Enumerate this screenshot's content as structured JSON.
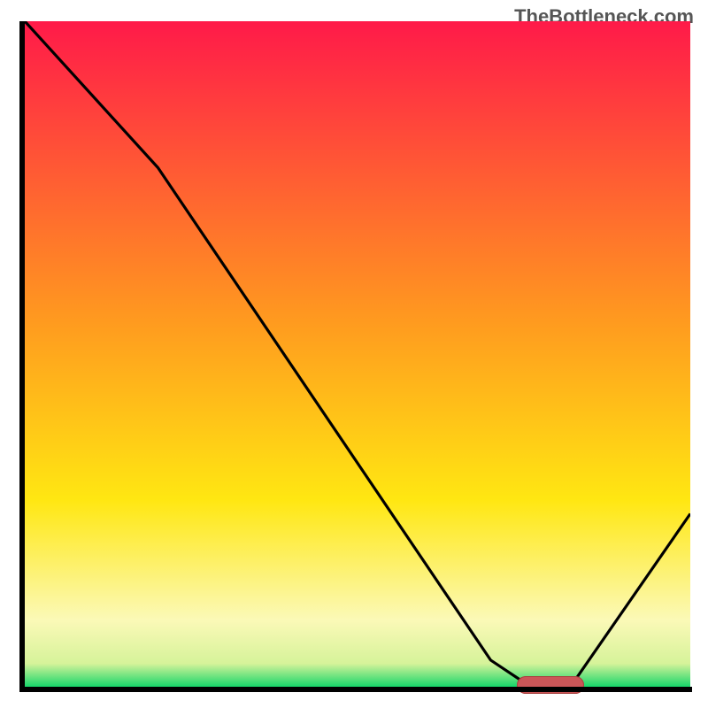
{
  "watermark": "TheBottleneck.com",
  "colors": {
    "axis": "#000000",
    "curve": "#000000",
    "marker": "#cb5658",
    "gradient_top": "#ff1a49",
    "gradient_mid1": "#ff9a1f",
    "gradient_mid2": "#ffe712",
    "gradient_band": "#fbf9b7",
    "gradient_bottom": "#17d66a"
  },
  "chart_data": {
    "type": "line",
    "title": "",
    "xlabel": "",
    "ylabel": "",
    "xlim": [
      0,
      100
    ],
    "ylim": [
      0,
      100
    ],
    "x": [
      0,
      20,
      70,
      76,
      82,
      100
    ],
    "values": [
      100,
      78,
      4,
      0,
      0,
      26
    ],
    "marker": {
      "x_start": 74,
      "x_end": 84,
      "y": 0
    },
    "gradient_stops": [
      {
        "pos": 0.0,
        "color": "#ff1a49"
      },
      {
        "pos": 0.45,
        "color": "#ff9a1f"
      },
      {
        "pos": 0.72,
        "color": "#ffe712"
      },
      {
        "pos": 0.9,
        "color": "#fbf9b7"
      },
      {
        "pos": 0.965,
        "color": "#d6f39a"
      },
      {
        "pos": 1.0,
        "color": "#17d66a"
      }
    ]
  }
}
